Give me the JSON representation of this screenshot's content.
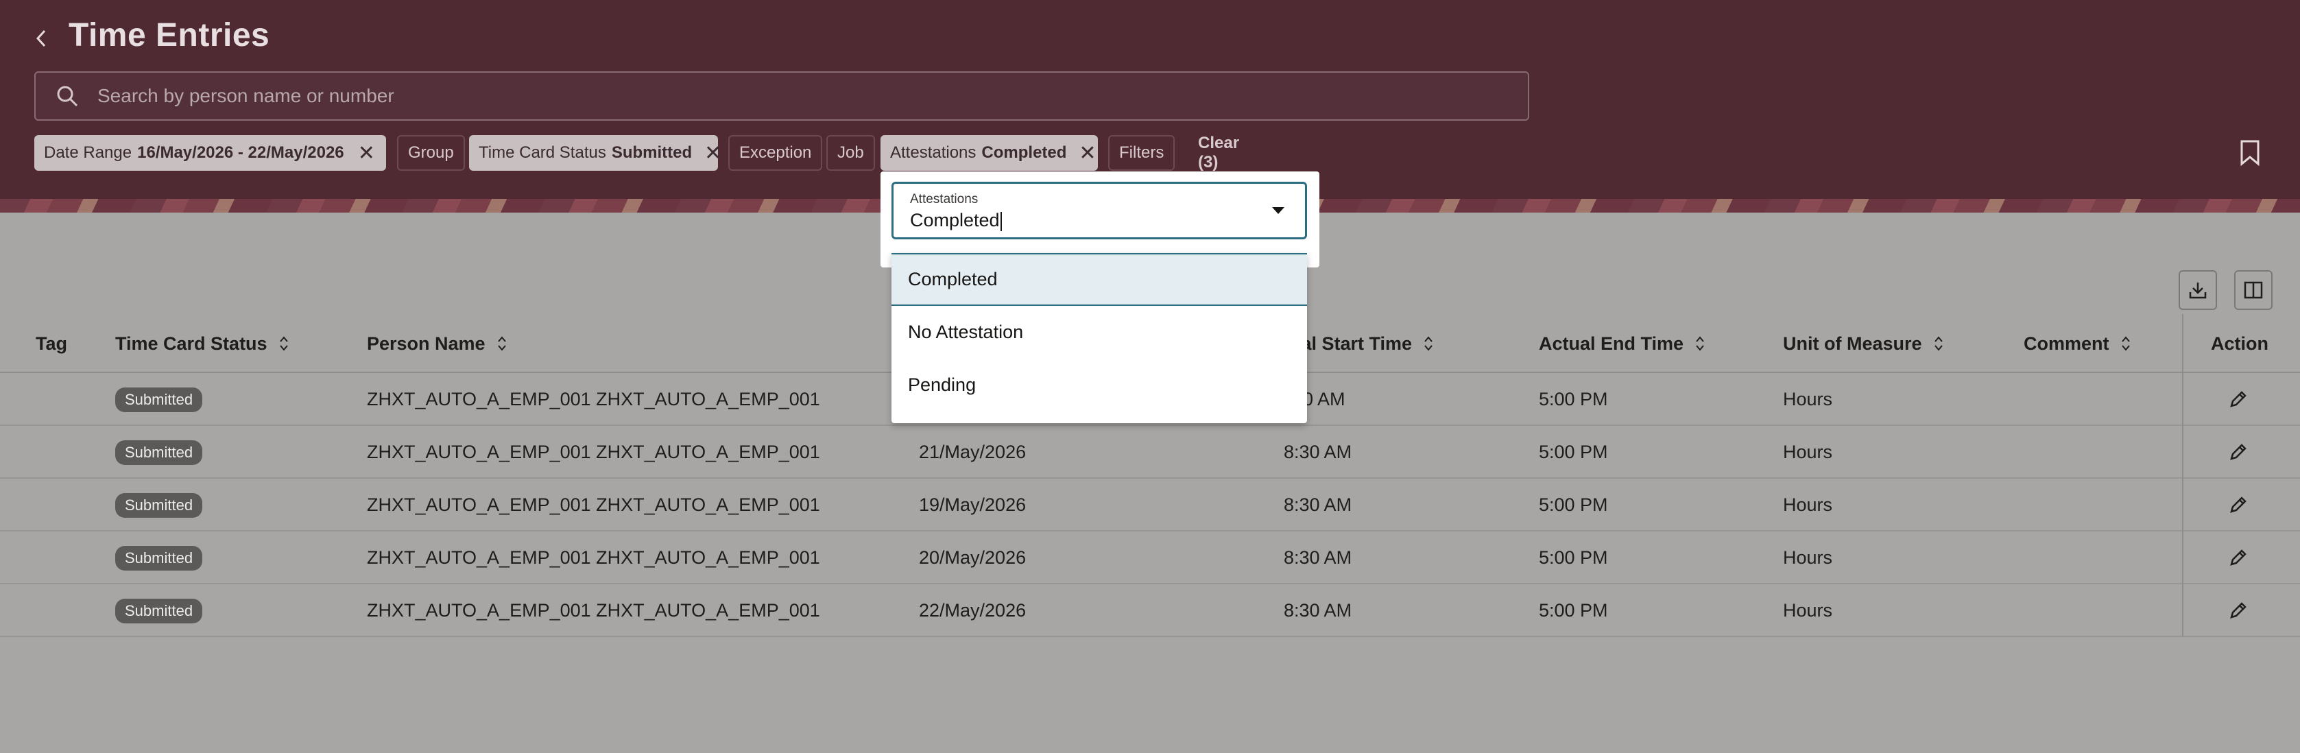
{
  "header": {
    "title": "Time Entries",
    "search_placeholder": "Search by person name or number"
  },
  "filters": {
    "date_range": {
      "label": "Date Range",
      "value": "16/May/2026 - 22/May/2026"
    },
    "group": {
      "label": "Group"
    },
    "time_card_status": {
      "label": "Time Card Status",
      "value": "Submitted"
    },
    "exception": {
      "label": "Exception"
    },
    "job": {
      "label": "Job"
    },
    "attestations": {
      "label": "Attestations",
      "value": "Completed"
    },
    "filters_label": "Filters",
    "clear_label": "Clear (3)"
  },
  "attestation_dropdown": {
    "label": "Attestations",
    "value": "Completed",
    "options": [
      "Completed",
      "No Attestation",
      "Pending"
    ],
    "selected_option": "Completed"
  },
  "table": {
    "columns": [
      "Tag",
      "Time Card Status",
      "Person Name",
      "tual Start Time",
      "Actual End Time",
      "Unit of Measure",
      "Comment",
      "Action"
    ],
    "rows": [
      {
        "status": "Submitted",
        "person": "ZHXT_AUTO_A_EMP_001 ZHXT_AUTO_A_EMP_001",
        "date": "",
        "start": "0 AM",
        "end": "5:00 PM",
        "uom": "Hours"
      },
      {
        "status": "Submitted",
        "person": "ZHXT_AUTO_A_EMP_001 ZHXT_AUTO_A_EMP_001",
        "date": "21/May/2026",
        "start": "8:30 AM",
        "end": "5:00 PM",
        "uom": "Hours"
      },
      {
        "status": "Submitted",
        "person": "ZHXT_AUTO_A_EMP_001 ZHXT_AUTO_A_EMP_001",
        "date": "19/May/2026",
        "start": "8:30 AM",
        "end": "5:00 PM",
        "uom": "Hours"
      },
      {
        "status": "Submitted",
        "person": "ZHXT_AUTO_A_EMP_001 ZHXT_AUTO_A_EMP_001",
        "date": "20/May/2026",
        "start": "8:30 AM",
        "end": "5:00 PM",
        "uom": "Hours"
      },
      {
        "status": "Submitted",
        "person": "ZHXT_AUTO_A_EMP_001 ZHXT_AUTO_A_EMP_001",
        "date": "22/May/2026",
        "start": "8:30 AM",
        "end": "5:00 PM",
        "uom": "Hours"
      }
    ]
  },
  "icons": {
    "back": "chevron-left-icon",
    "search": "search-icon",
    "bookmark": "bookmark-icon",
    "download": "download-icon",
    "columns": "columns-icon",
    "edit": "pencil-icon"
  },
  "colors": {
    "header_bg": "#4f2a33",
    "focus_accent": "#2d6d84",
    "overlay_bg": "#a8a6a4"
  }
}
